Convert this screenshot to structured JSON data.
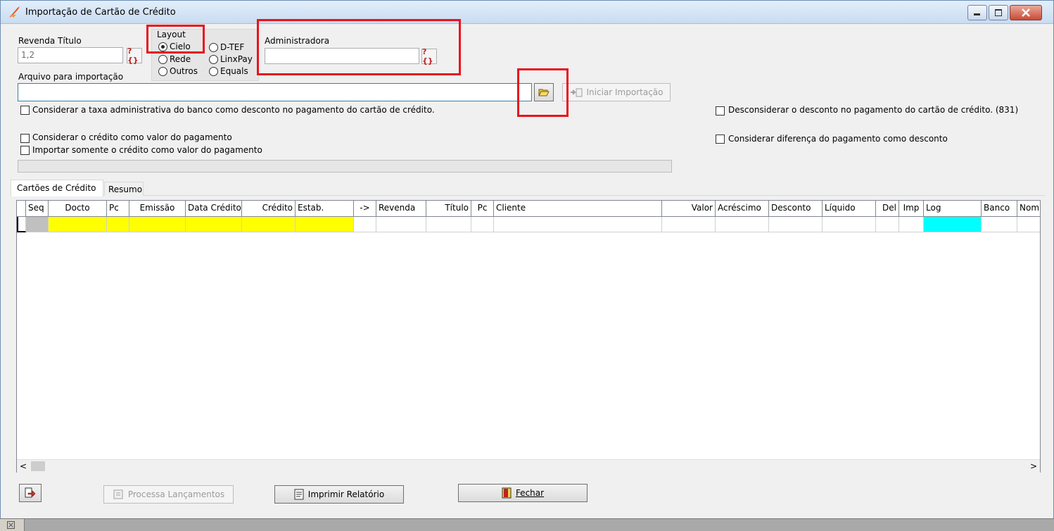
{
  "window": {
    "title": "Importação de Cartão de Crédito"
  },
  "revenda_titulo": {
    "label": "Revenda Título",
    "value": "1,2",
    "lookup_button": "?{}"
  },
  "layout": {
    "label": "Layout",
    "options": [
      {
        "label": "Cielo",
        "selected": true
      },
      {
        "label": "Rede",
        "selected": false
      },
      {
        "label": "Outros",
        "selected": false
      },
      {
        "label": "D-TEF",
        "selected": false
      },
      {
        "label": "LinxPay",
        "selected": false
      },
      {
        "label": "Equals",
        "selected": false
      }
    ]
  },
  "administradora": {
    "label": "Administradora",
    "value": "",
    "lookup_button": "?{}"
  },
  "arquivo": {
    "label": "Arquivo para importação",
    "value": ""
  },
  "iniciar_importacao": {
    "label": "Iniciar Importação"
  },
  "options": {
    "taxa_admin": "Considerar a taxa administrativa do banco como desconto no pagamento do cartão de crédito.",
    "credito_valor": "Considerar o crédito como valor do pagamento",
    "somente_credito": "Importar somente o crédito como valor do pagamento",
    "desconsiderar_desconto": "Desconsiderar o desconto no pagamento do cartão de crédito. (831)",
    "diferenca_desconto": "Considerar diferença do pagamento como desconto"
  },
  "progress": 0,
  "tabs": [
    {
      "label": "Cartões de Crédito",
      "active": true
    },
    {
      "label": "Resumo",
      "active": false
    }
  ],
  "grid": {
    "columns": [
      "Seq",
      "Docto",
      "Pc",
      "Emissão",
      "Data Crédito",
      "Crédito",
      "Estab.",
      "->",
      "Revenda",
      "Título",
      "Pc",
      "Cliente",
      "Valor",
      "Acréscimo",
      "Desconto",
      "Líquido",
      "Del",
      "Imp",
      "Log",
      "Banco",
      "Nom"
    ],
    "colors": {
      "yellow": "#ffff00",
      "cyan": "#00ffff",
      "gray": "#c0c0c0"
    }
  },
  "footer": {
    "processa": "Processa Lançamentos",
    "imprimir": "Imprimir Relatório",
    "fechar": "Fechar"
  },
  "statusbar": {
    "icon": "close-small-icon"
  }
}
